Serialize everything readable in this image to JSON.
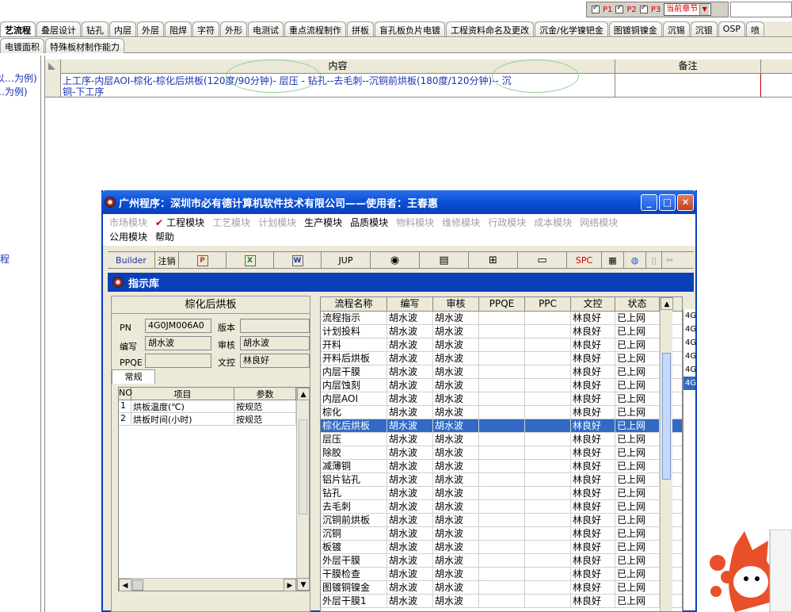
{
  "topbar": {
    "p1": "P1",
    "p2": "P2",
    "p3": "P3",
    "chapter_select": "当前章节"
  },
  "main_tabs": [
    "艺流程",
    "叠层设计",
    "钻孔",
    "内层",
    "外层",
    "阻焊",
    "字符",
    "外形",
    "电测试",
    "重点流程制作",
    "拼板",
    "盲孔板负片电镀",
    "工程资料命名及更改",
    "沉金/化学镍钯金",
    "图镀铜镍金",
    "沉锡",
    "沉银",
    "OSP",
    "喷"
  ],
  "sub_tabs": [
    "电镀面积",
    "特殊板材制作能力"
  ],
  "left_panel": {
    "line1": "以…为例)",
    "line2": "…为例)",
    "line3": "程"
  },
  "grid": {
    "col_content": "内容",
    "col_note": "备注",
    "row1_line1": "上工序-内层AOI-棕化-棕化后烘板(120度/90分钟)- 层压 - 钻孔--去毛刺--沉铜前烘板(180度/120分钟)-- 沉",
    "row1_line2": "铜-下工序"
  },
  "window": {
    "title": "广州程序：深圳市必有德计算机软件技术有限公司——使用者：王春惠",
    "menu_row1": [
      "市场模块",
      "工程模块",
      "工艺模块",
      "计划模块",
      "生产模块",
      "品质模块",
      "物料模块",
      "维修模块",
      "行政模块",
      "成本模块",
      "网络模块"
    ],
    "menu_row2": [
      "公用模块",
      "帮助"
    ],
    "toolbar": {
      "builder": "Builder",
      "logout": "注销",
      "jup": "JUP",
      "spc": "SPC"
    },
    "tab_title": "指示库"
  },
  "detail": {
    "title": "棕化后烘板",
    "pn_label": "PN",
    "pn_value": "4G0JM006A0",
    "version_label": "版本",
    "version_value": "",
    "author_label": "编写",
    "author_value": "胡水波",
    "reviewer_label": "审核",
    "reviewer_value": "胡水波",
    "ppqe_label": "PPQE",
    "ppqe_value": "",
    "doc_label": "文控",
    "doc_value": "林良好",
    "tab_general": "常规",
    "param_headers": [
      "NO",
      "项目",
      "参数"
    ],
    "params": [
      [
        "1",
        "烘板温度(℃)",
        "按规范"
      ],
      [
        "2",
        "烘板时间(小时)",
        "按规范"
      ]
    ]
  },
  "flow_list": {
    "headers": [
      "流程名称",
      "编写",
      "审核",
      "PPQE",
      "PPC",
      "文控",
      "状态"
    ],
    "selected_index": 8,
    "rows": [
      [
        "流程指示",
        "胡水波",
        "胡水波",
        "",
        "",
        "林良好",
        "已上网"
      ],
      [
        "计划投料",
        "胡水波",
        "胡水波",
        "",
        "",
        "林良好",
        "已上网"
      ],
      [
        "开料",
        "胡水波",
        "胡水波",
        "",
        "",
        "林良好",
        "已上网"
      ],
      [
        "开料后烘板",
        "胡水波",
        "胡水波",
        "",
        "",
        "林良好",
        "已上网"
      ],
      [
        "内层干膜",
        "胡水波",
        "胡水波",
        "",
        "",
        "林良好",
        "已上网"
      ],
      [
        "内层蚀刻",
        "胡水波",
        "胡水波",
        "",
        "",
        "林良好",
        "已上网"
      ],
      [
        "内层AOI",
        "胡水波",
        "胡水波",
        "",
        "",
        "林良好",
        "已上网"
      ],
      [
        "棕化",
        "胡水波",
        "胡水波",
        "",
        "",
        "林良好",
        "已上网"
      ],
      [
        "棕化后烘板",
        "胡水波",
        "胡水波",
        "",
        "",
        "林良好",
        "已上网"
      ],
      [
        "层压",
        "胡水波",
        "胡水波",
        "",
        "",
        "林良好",
        "已上网"
      ],
      [
        "除胶",
        "胡水波",
        "胡水波",
        "",
        "",
        "林良好",
        "已上网"
      ],
      [
        "减薄铜",
        "胡水波",
        "胡水波",
        "",
        "",
        "林良好",
        "已上网"
      ],
      [
        "铝片钻孔",
        "胡水波",
        "胡水波",
        "",
        "",
        "林良好",
        "已上网"
      ],
      [
        "钻孔",
        "胡水波",
        "胡水波",
        "",
        "",
        "林良好",
        "已上网"
      ],
      [
        "去毛刺",
        "胡水波",
        "胡水波",
        "",
        "",
        "林良好",
        "已上网"
      ],
      [
        "沉铜前烘板",
        "胡水波",
        "胡水波",
        "",
        "",
        "林良好",
        "已上网"
      ],
      [
        "沉铜",
        "胡水波",
        "胡水波",
        "",
        "",
        "林良好",
        "已上网"
      ],
      [
        "板镀",
        "胡水波",
        "胡水波",
        "",
        "",
        "林良好",
        "已上网"
      ],
      [
        "外层干膜",
        "胡水波",
        "胡水波",
        "",
        "",
        "林良好",
        "已上网"
      ],
      [
        "干膜检查",
        "胡水波",
        "胡水波",
        "",
        "",
        "林良好",
        "已上网"
      ],
      [
        "图镀铜镍金",
        "胡水波",
        "胡水波",
        "",
        "",
        "林良好",
        "已上网"
      ],
      [
        "外层干膜1",
        "胡水波",
        "胡水波",
        "",
        "",
        "林良好",
        "已上网"
      ]
    ]
  },
  "right_edge": [
    "4G",
    "4G",
    "4G",
    "4G",
    "4G",
    "4G"
  ]
}
